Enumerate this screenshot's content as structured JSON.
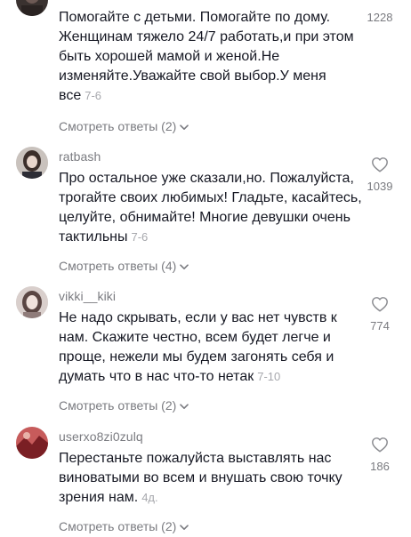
{
  "comments": [
    {
      "username": "",
      "text": "Помогайте с детьми. Помогайте по дому. Женщинам тяжело 24/7 работать,и при этом быть хорошей мамой и женой.Не изменяйте.Уважайте свой выбор.У меня все",
      "date": "7-6",
      "replies_label": "Смотреть ответы (2)",
      "likes": "1228"
    },
    {
      "username": "ratbash",
      "text": "Про остальное уже сказали,но. Пожалуйста, трогайте своих любимых! Гладьте, касайтесь, целуйте, обнимайте! Многие девушки очень тактильны",
      "date": "7-6",
      "replies_label": "Смотреть ответы (4)",
      "likes": "1039"
    },
    {
      "username": "vikki__kiki",
      "text": "Не надо скрывать, если у вас нет чувств к нам. Скажите честно, всем будет легче и проще, нежели мы будем загонять себя и думать что в нас что-то нетак",
      "date": "7-10",
      "replies_label": "Смотреть ответы (2)",
      "likes": "774"
    },
    {
      "username": "userxo8zi0zulq",
      "text": "Перестаньте пожалуйста выставлять нас виноватыми во всем и внушать свою точку зрения нам.",
      "date": "4д.",
      "replies_label": "Смотреть ответы (2)",
      "likes": "186"
    }
  ],
  "icons": {
    "like": "heart-outline-icon",
    "expand": "chevron-down-icon"
  },
  "colors": {
    "text": "#161823",
    "secondary": "#7a7b80",
    "date": "#a7a8ad"
  }
}
